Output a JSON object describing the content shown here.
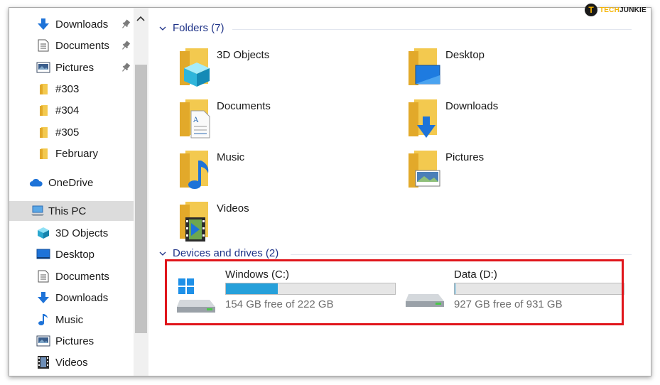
{
  "watermark": {
    "part1": "TECH",
    "part2": "JUNKIE",
    "logo_letter": "T"
  },
  "nav": {
    "quick_access": [
      {
        "label": "Downloads",
        "icon": "download-arrow-icon",
        "pinned": true
      },
      {
        "label": "Documents",
        "icon": "document-icon",
        "pinned": true
      },
      {
        "label": "Pictures",
        "icon": "pictures-icon",
        "pinned": true
      },
      {
        "label": "#303",
        "icon": "folder-icon",
        "pinned": false
      },
      {
        "label": "#304",
        "icon": "folder-icon",
        "pinned": false
      },
      {
        "label": "#305",
        "icon": "folder-icon",
        "pinned": false
      },
      {
        "label": "February",
        "icon": "folder-icon",
        "pinned": false
      }
    ],
    "onedrive": {
      "label": "OneDrive",
      "icon": "cloud-icon"
    },
    "this_pc": {
      "label": "This PC",
      "icon": "computer-icon",
      "selected": true
    },
    "this_pc_items": [
      {
        "label": "3D Objects",
        "icon": "cube-icon"
      },
      {
        "label": "Desktop",
        "icon": "desktop-icon"
      },
      {
        "label": "Documents",
        "icon": "document-icon"
      },
      {
        "label": "Downloads",
        "icon": "download-arrow-icon"
      },
      {
        "label": "Music",
        "icon": "music-note-icon"
      },
      {
        "label": "Pictures",
        "icon": "pictures-icon"
      },
      {
        "label": "Videos",
        "icon": "film-icon"
      }
    ]
  },
  "folders_group": {
    "header": "Folders (7)",
    "items": [
      {
        "name": "3D Objects",
        "icon": "folder-3d-objects-icon"
      },
      {
        "name": "Desktop",
        "icon": "folder-desktop-icon"
      },
      {
        "name": "Documents",
        "icon": "folder-documents-icon"
      },
      {
        "name": "Downloads",
        "icon": "folder-downloads-icon"
      },
      {
        "name": "Music",
        "icon": "folder-music-icon"
      },
      {
        "name": "Pictures",
        "icon": "folder-pictures-icon"
      },
      {
        "name": "Videos",
        "icon": "folder-videos-icon"
      }
    ]
  },
  "drives_group": {
    "header": "Devices and drives (2)",
    "drives": [
      {
        "name": "Windows (C:)",
        "free_text": "154 GB free of 222 GB",
        "used_fraction": 0.306,
        "icon": "windows-drive-icon"
      },
      {
        "name": "Data (D:)",
        "free_text": "927 GB free of 931 GB",
        "used_fraction": 0.004,
        "icon": "hard-drive-icon"
      }
    ]
  },
  "colors": {
    "accent": "#26a0da",
    "highlight": "#e0151b",
    "group_header": "#1e3287",
    "folder": "#f3c94f"
  }
}
